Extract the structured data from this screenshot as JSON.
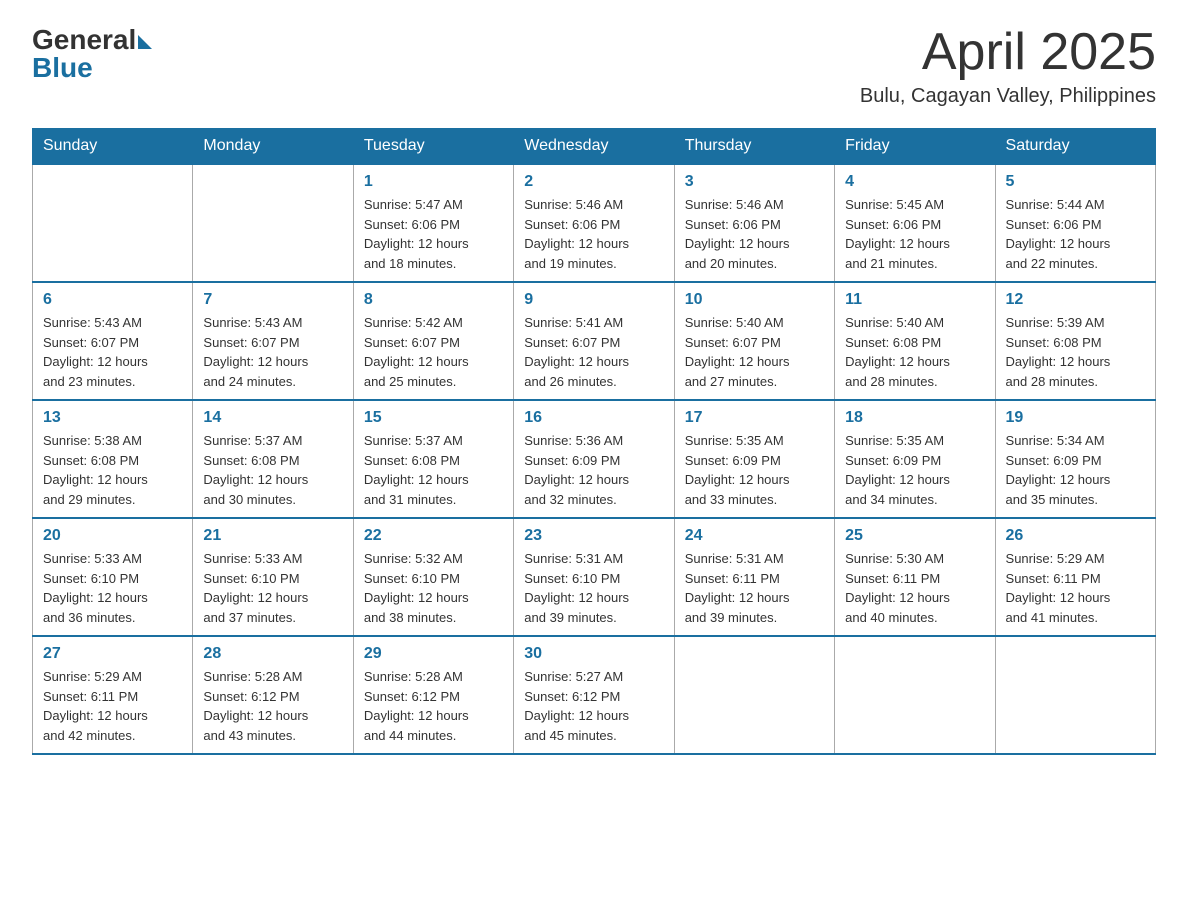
{
  "header": {
    "logo_general": "General",
    "logo_blue": "Blue",
    "month_title": "April 2025",
    "location": "Bulu, Cagayan Valley, Philippines"
  },
  "weekdays": [
    "Sunday",
    "Monday",
    "Tuesday",
    "Wednesday",
    "Thursday",
    "Friday",
    "Saturday"
  ],
  "weeks": [
    [
      null,
      null,
      {
        "day": "1",
        "sunrise": "5:47 AM",
        "sunset": "6:06 PM",
        "daylight": "12 hours and 18 minutes."
      },
      {
        "day": "2",
        "sunrise": "5:46 AM",
        "sunset": "6:06 PM",
        "daylight": "12 hours and 19 minutes."
      },
      {
        "day": "3",
        "sunrise": "5:46 AM",
        "sunset": "6:06 PM",
        "daylight": "12 hours and 20 minutes."
      },
      {
        "day": "4",
        "sunrise": "5:45 AM",
        "sunset": "6:06 PM",
        "daylight": "12 hours and 21 minutes."
      },
      {
        "day": "5",
        "sunrise": "5:44 AM",
        "sunset": "6:06 PM",
        "daylight": "12 hours and 22 minutes."
      }
    ],
    [
      {
        "day": "6",
        "sunrise": "5:43 AM",
        "sunset": "6:07 PM",
        "daylight": "12 hours and 23 minutes."
      },
      {
        "day": "7",
        "sunrise": "5:43 AM",
        "sunset": "6:07 PM",
        "daylight": "12 hours and 24 minutes."
      },
      {
        "day": "8",
        "sunrise": "5:42 AM",
        "sunset": "6:07 PM",
        "daylight": "12 hours and 25 minutes."
      },
      {
        "day": "9",
        "sunrise": "5:41 AM",
        "sunset": "6:07 PM",
        "daylight": "12 hours and 26 minutes."
      },
      {
        "day": "10",
        "sunrise": "5:40 AM",
        "sunset": "6:07 PM",
        "daylight": "12 hours and 27 minutes."
      },
      {
        "day": "11",
        "sunrise": "5:40 AM",
        "sunset": "6:08 PM",
        "daylight": "12 hours and 28 minutes."
      },
      {
        "day": "12",
        "sunrise": "5:39 AM",
        "sunset": "6:08 PM",
        "daylight": "12 hours and 28 minutes."
      }
    ],
    [
      {
        "day": "13",
        "sunrise": "5:38 AM",
        "sunset": "6:08 PM",
        "daylight": "12 hours and 29 minutes."
      },
      {
        "day": "14",
        "sunrise": "5:37 AM",
        "sunset": "6:08 PM",
        "daylight": "12 hours and 30 minutes."
      },
      {
        "day": "15",
        "sunrise": "5:37 AM",
        "sunset": "6:08 PM",
        "daylight": "12 hours and 31 minutes."
      },
      {
        "day": "16",
        "sunrise": "5:36 AM",
        "sunset": "6:09 PM",
        "daylight": "12 hours and 32 minutes."
      },
      {
        "day": "17",
        "sunrise": "5:35 AM",
        "sunset": "6:09 PM",
        "daylight": "12 hours and 33 minutes."
      },
      {
        "day": "18",
        "sunrise": "5:35 AM",
        "sunset": "6:09 PM",
        "daylight": "12 hours and 34 minutes."
      },
      {
        "day": "19",
        "sunrise": "5:34 AM",
        "sunset": "6:09 PM",
        "daylight": "12 hours and 35 minutes."
      }
    ],
    [
      {
        "day": "20",
        "sunrise": "5:33 AM",
        "sunset": "6:10 PM",
        "daylight": "12 hours and 36 minutes."
      },
      {
        "day": "21",
        "sunrise": "5:33 AM",
        "sunset": "6:10 PM",
        "daylight": "12 hours and 37 minutes."
      },
      {
        "day": "22",
        "sunrise": "5:32 AM",
        "sunset": "6:10 PM",
        "daylight": "12 hours and 38 minutes."
      },
      {
        "day": "23",
        "sunrise": "5:31 AM",
        "sunset": "6:10 PM",
        "daylight": "12 hours and 39 minutes."
      },
      {
        "day": "24",
        "sunrise": "5:31 AM",
        "sunset": "6:11 PM",
        "daylight": "12 hours and 39 minutes."
      },
      {
        "day": "25",
        "sunrise": "5:30 AM",
        "sunset": "6:11 PM",
        "daylight": "12 hours and 40 minutes."
      },
      {
        "day": "26",
        "sunrise": "5:29 AM",
        "sunset": "6:11 PM",
        "daylight": "12 hours and 41 minutes."
      }
    ],
    [
      {
        "day": "27",
        "sunrise": "5:29 AM",
        "sunset": "6:11 PM",
        "daylight": "12 hours and 42 minutes."
      },
      {
        "day": "28",
        "sunrise": "5:28 AM",
        "sunset": "6:12 PM",
        "daylight": "12 hours and 43 minutes."
      },
      {
        "day": "29",
        "sunrise": "5:28 AM",
        "sunset": "6:12 PM",
        "daylight": "12 hours and 44 minutes."
      },
      {
        "day": "30",
        "sunrise": "5:27 AM",
        "sunset": "6:12 PM",
        "daylight": "12 hours and 45 minutes."
      },
      null,
      null,
      null
    ]
  ],
  "labels": {
    "sunrise": "Sunrise:",
    "sunset": "Sunset:",
    "daylight": "Daylight:"
  }
}
